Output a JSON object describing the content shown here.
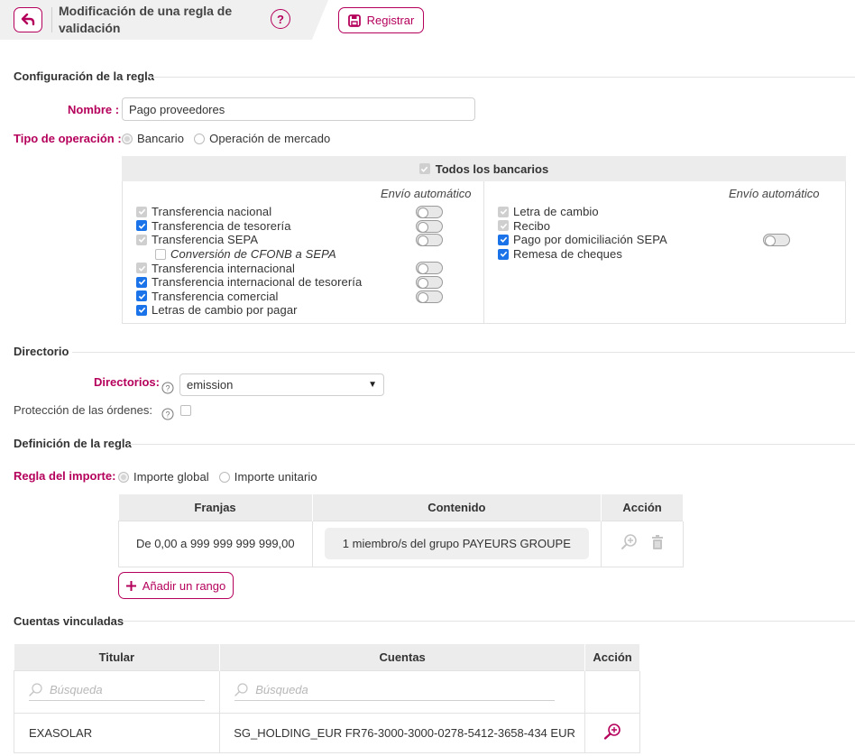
{
  "header": {
    "title": "Modificación de una regla de validación",
    "help": "?",
    "register_label": "Registrar"
  },
  "config": {
    "section_title": "Configuración de la regla",
    "name_label": "Nombre :",
    "name_value": "Pago proveedores",
    "op_type_label": "Tipo de operación :",
    "op_bancario": "Bancario",
    "op_mercado": "Operación de mercado",
    "todos_label": "Todos los bancarios",
    "envio_label": "Envío automático",
    "left_items": [
      {
        "label": "Transferencia nacional",
        "state": "disabled",
        "toggle": true
      },
      {
        "label": "Transferencia de tesorería",
        "state": "on",
        "toggle": true
      },
      {
        "label": "Transferencia SEPA",
        "state": "disabled",
        "toggle": true
      },
      {
        "label": "Conversión de CFONB a SEPA",
        "state": "off",
        "toggle": false
      },
      {
        "label": "Transferencia internacional",
        "state": "disabled",
        "toggle": true
      },
      {
        "label": "Transferencia internacional de tesorería",
        "state": "on",
        "toggle": true
      },
      {
        "label": "Transferencia comercial",
        "state": "on",
        "toggle": true
      },
      {
        "label": "Letras de cambio por pagar",
        "state": "on",
        "toggle": false
      }
    ],
    "right_items": [
      {
        "label": "Letra de cambio",
        "state": "disabled",
        "toggle": false
      },
      {
        "label": "Recibo",
        "state": "disabled",
        "toggle": false
      },
      {
        "label": "Pago por domiciliación SEPA",
        "state": "on",
        "toggle": true
      },
      {
        "label": "Remesa de cheques",
        "state": "on",
        "toggle": false
      }
    ]
  },
  "directorio": {
    "section_title": "Directorio",
    "dirs_label": "Directorios:",
    "dirs_value": "emission",
    "protection_label": "Protección de las órdenes:"
  },
  "definicion": {
    "section_title": "Definición de la regla",
    "importe_label": "Regla del importe:",
    "importe_global": "Importe global",
    "importe_unitario": "Importe unitario",
    "table_headers": [
      "Franjas",
      "Contenido",
      "Acción"
    ],
    "rows": [
      {
        "franja": "De 0,00 a 999 999 999 999,00",
        "contenido": "1 miembro/s del grupo PAYEURS GROUPE"
      }
    ],
    "add_range_label": "Añadir un rango"
  },
  "cuentas": {
    "section_title": "Cuentas vinculadas",
    "table_headers": [
      "Titular",
      "Cuentas",
      "Acción"
    ],
    "search_placeholder": "Búsqueda",
    "rows": [
      {
        "titular": "EXASOLAR",
        "cuenta": "SG_HOLDING_EUR FR76-3000-3000-0278-5412-3658-434 EUR"
      }
    ]
  },
  "colors": {
    "accent": "#b5005b",
    "checkbox": "#1a73e8",
    "header_bg": "#ececec"
  }
}
